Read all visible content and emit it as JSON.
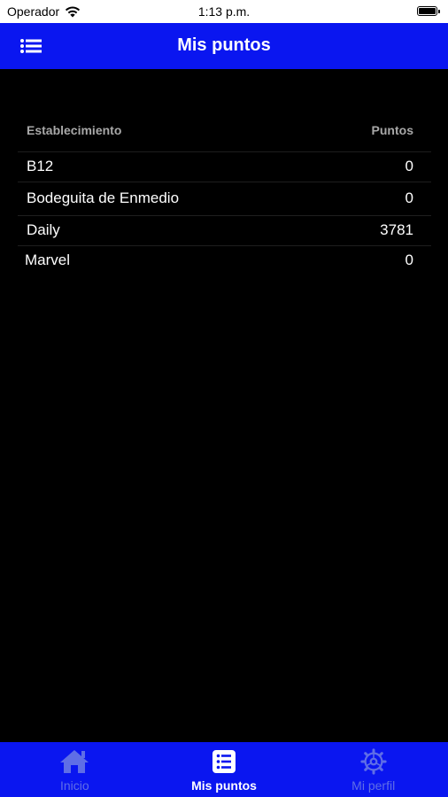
{
  "status_bar": {
    "carrier": "Operador",
    "time": "1:13 p.m."
  },
  "header": {
    "title": "Mis puntos",
    "menu_icon": "list-icon"
  },
  "table": {
    "col_establishment": "Establecimiento",
    "col_points": "Puntos",
    "rows": [
      {
        "name": "B12",
        "points": "0"
      },
      {
        "name": "Bodeguita de Enmedio",
        "points": "0"
      },
      {
        "name": "Daily",
        "points": "3781"
      },
      {
        "name": "Marvel",
        "points": "0"
      }
    ]
  },
  "tabs": [
    {
      "label": "Inicio",
      "icon": "home-icon",
      "active": false
    },
    {
      "label": "Mis puntos",
      "icon": "list-icon",
      "active": true
    },
    {
      "label": "Mi perfil",
      "icon": "gear-icon",
      "active": false
    }
  ],
  "colors": {
    "primary": "#0a16f0",
    "inactive_tab": "#5f6ee6",
    "background": "#000000",
    "header_text": "#a8a8a8"
  }
}
